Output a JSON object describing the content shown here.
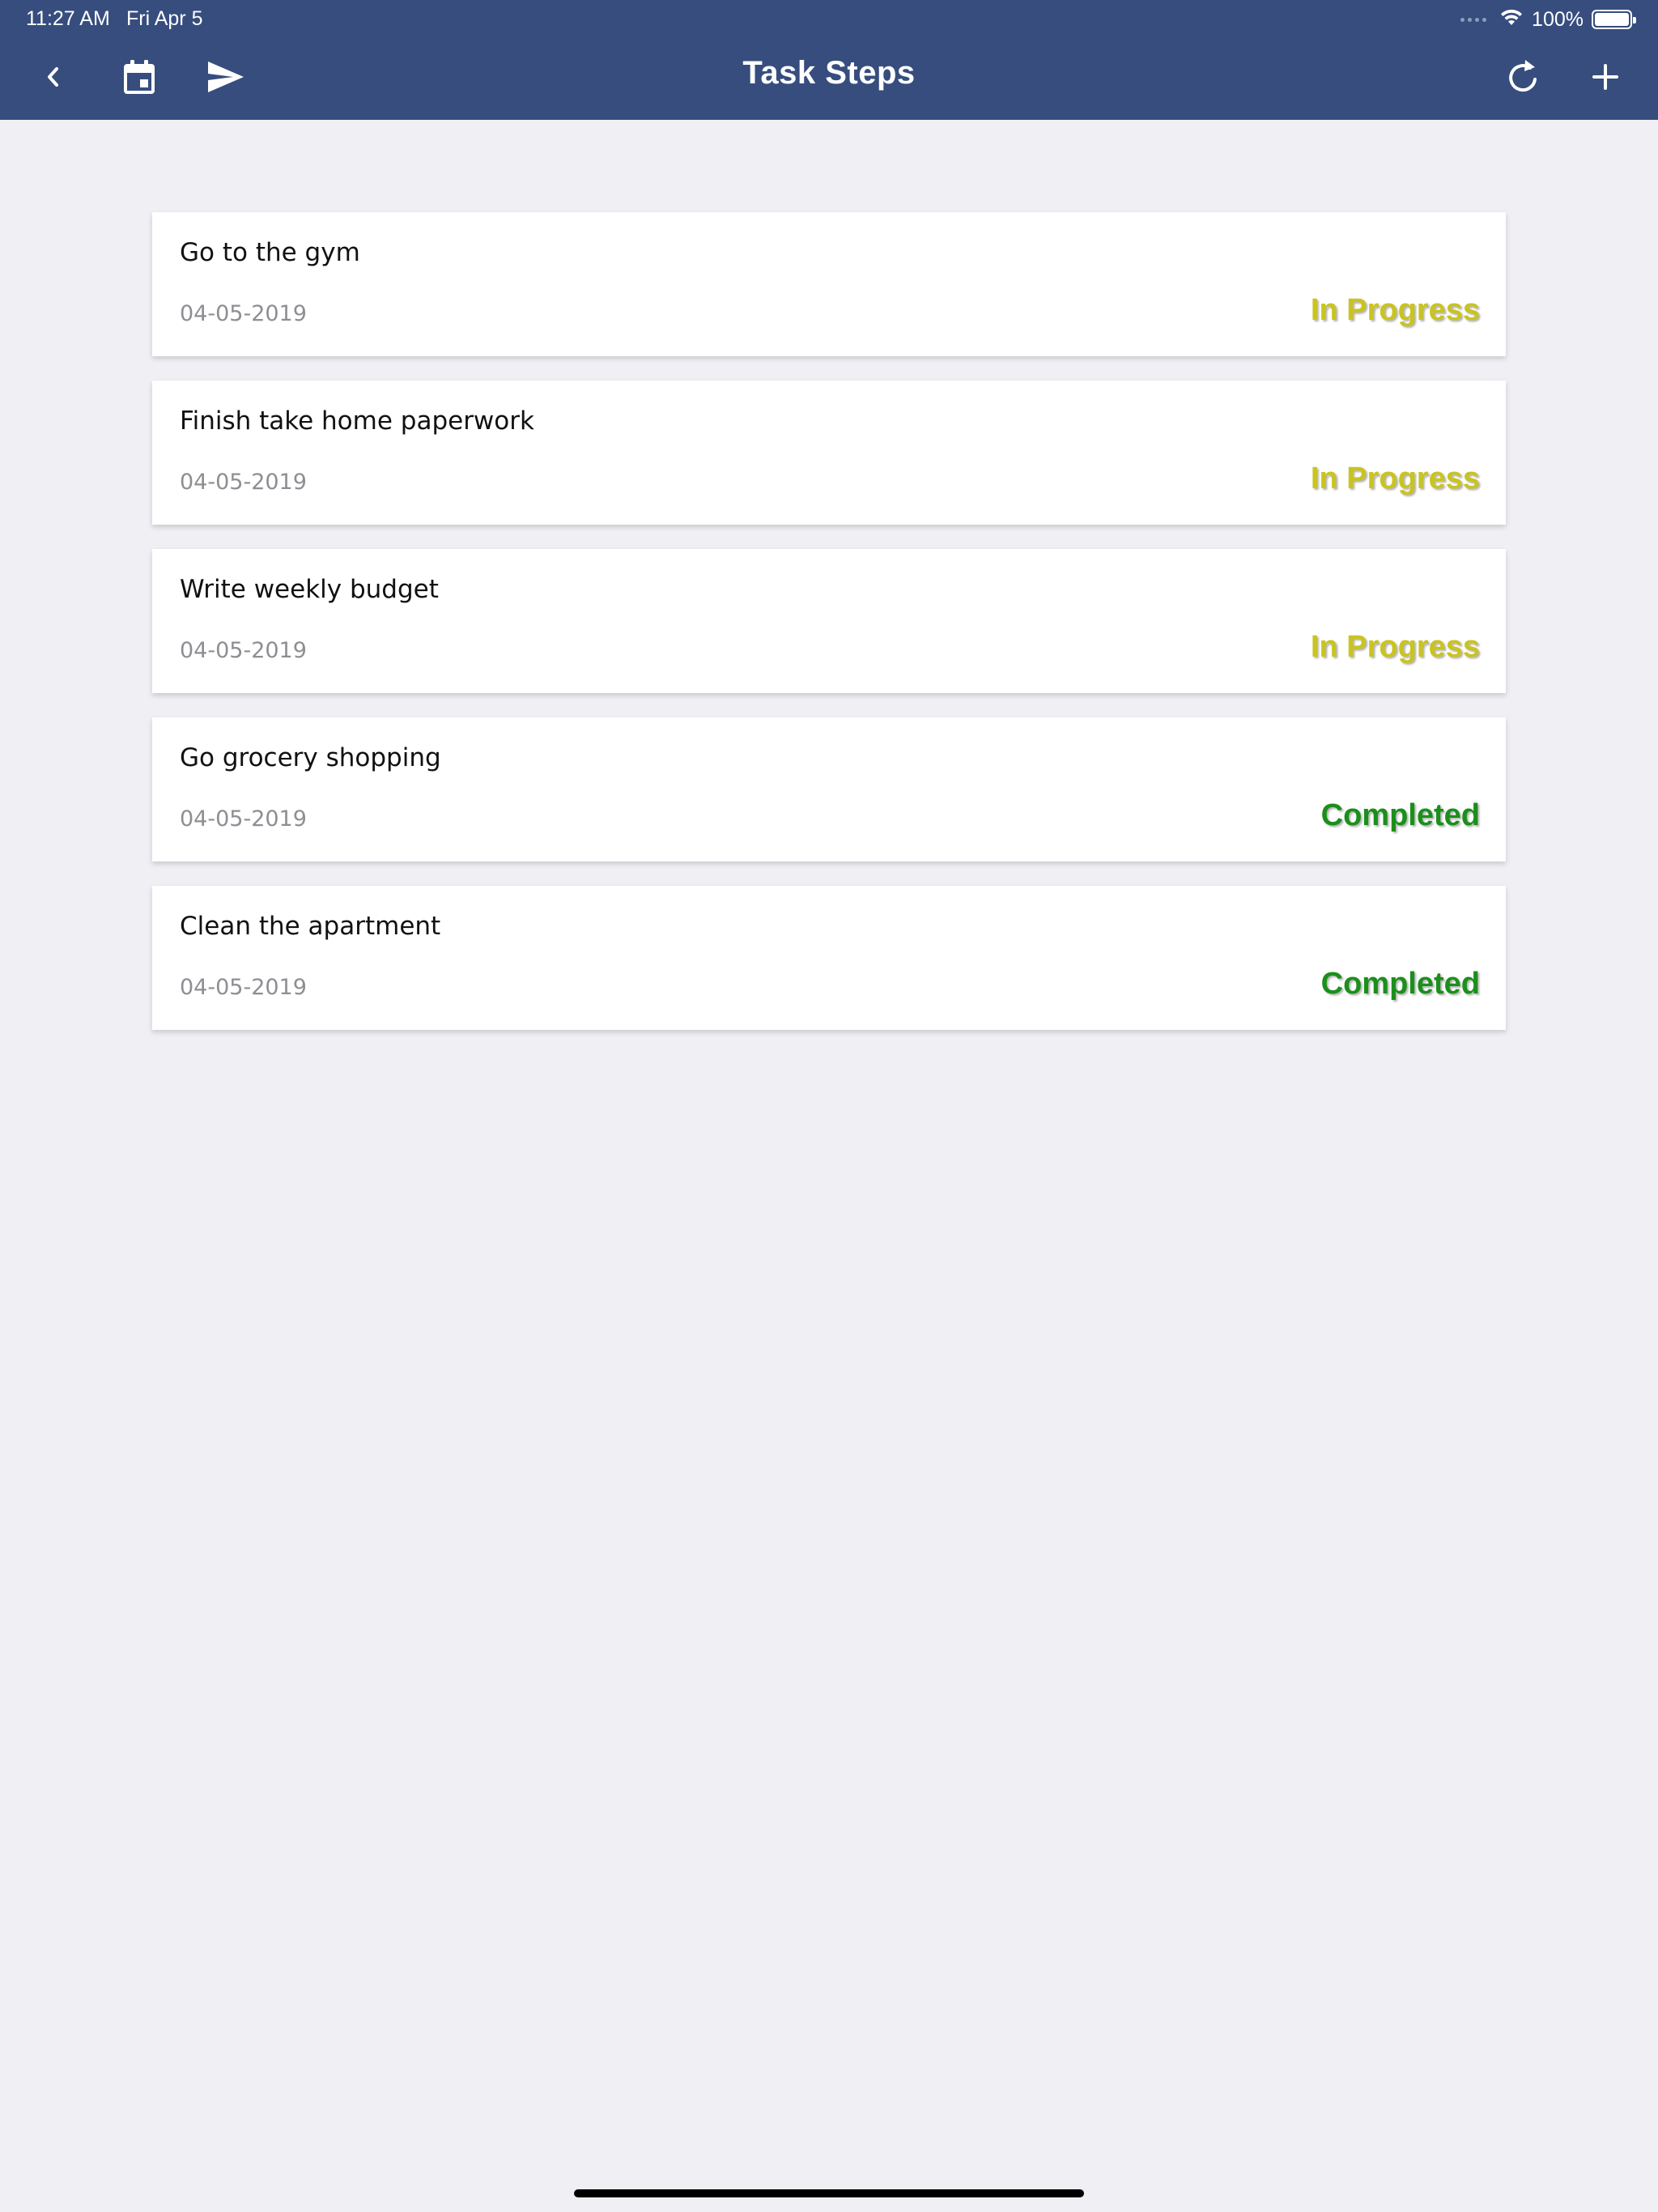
{
  "status_bar": {
    "time": "11:27 AM",
    "date": "Fri Apr 5",
    "battery": "100%"
  },
  "header": {
    "title": "Task Steps",
    "background_color": "#364d7e",
    "icons": {
      "back": "chevron-left-icon",
      "calendar": "calendar-icon",
      "send": "send-icon",
      "refresh": "refresh-icon",
      "add": "plus-icon"
    }
  },
  "tasks": [
    {
      "name": "Go to the gym",
      "date": "04-05-2019",
      "status": "In Progress"
    },
    {
      "name": "Finish take home paperwork",
      "date": "04-05-2019",
      "status": "In Progress"
    },
    {
      "name": "Write weekly budget",
      "date": "04-05-2019",
      "status": "In Progress"
    },
    {
      "name": "Go grocery shopping",
      "date": "04-05-2019",
      "status": "Completed"
    },
    {
      "name": "Clean the apartment",
      "date": "04-05-2019",
      "status": "Completed"
    }
  ],
  "status_colors": {
    "In Progress": "#c9c41f",
    "Completed": "#1b8f1b"
  }
}
